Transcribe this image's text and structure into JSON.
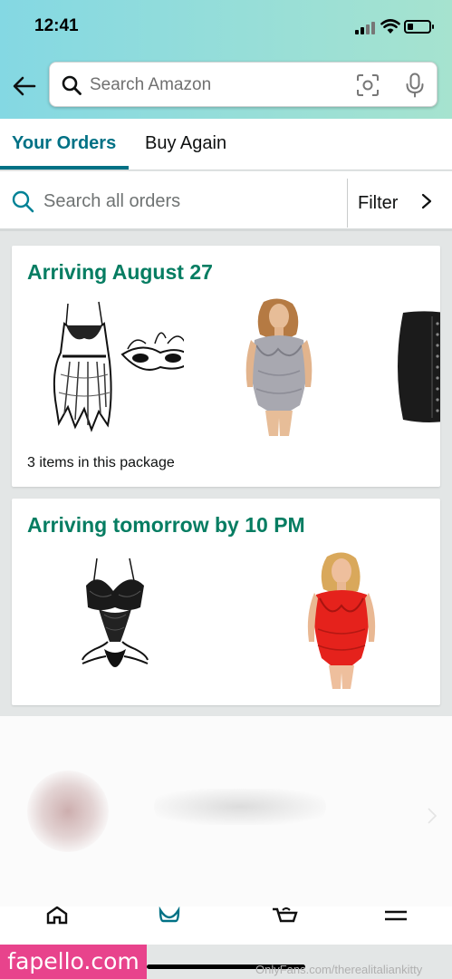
{
  "status_bar": {
    "time": "12:41"
  },
  "search": {
    "placeholder": "Search Amazon"
  },
  "tabs": [
    {
      "label": "Your Orders",
      "active": true
    },
    {
      "label": "Buy Again",
      "active": false
    }
  ],
  "order_search": {
    "placeholder": "Search all orders",
    "filter_label": "Filter"
  },
  "orders": [
    {
      "title": "Arriving August 27",
      "subtitle": "3 items in this package",
      "items": [
        "lace-babydoll-and-mask-image",
        "grey-lace-bodysuit-image",
        "black-waist-trainer-image"
      ]
    },
    {
      "title": "Arriving tomorrow by 10 PM",
      "items": [
        "black-lace-teddy-image",
        "red-lace-bodysuit-image"
      ]
    }
  ],
  "watermark": {
    "site": "fapello.com",
    "source": "OnlyFans.com/therealitaliankitty"
  },
  "colors": {
    "accent": "#007185",
    "arrival_green": "#067d62",
    "header_gradient": [
      "#84d8e3",
      "#a6e3cf"
    ]
  }
}
